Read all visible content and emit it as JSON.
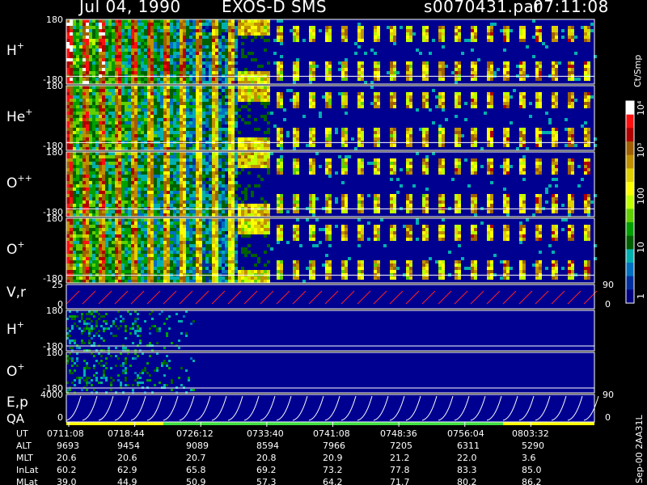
{
  "header": {
    "date": "Jul 04, 1990",
    "instrument": "EXOS-D SMS",
    "file": "s0070431.par",
    "file_time": "07:11:08"
  },
  "chart_data": {
    "type": "heatmap",
    "time_ticks": [
      "0711:08",
      "0718:44",
      "0726:12",
      "0733:40",
      "0741:08",
      "0748:36",
      "0756:04",
      "0803:32"
    ],
    "panels": [
      {
        "id": "h-plus",
        "ion": "H",
        "sup": "+",
        "ymax": "180",
        "ymin": "-180"
      },
      {
        "id": "he-plus",
        "ion": "He",
        "sup": "+",
        "ymax": "180",
        "ymin": "-180"
      },
      {
        "id": "o-plus-plus",
        "ion": "O",
        "sup": "++",
        "ymax": "180",
        "ymin": "-180"
      },
      {
        "id": "o-plus",
        "ion": "O",
        "sup": "+",
        "ymax": "180",
        "ymin": "-180"
      },
      {
        "id": "vr",
        "ion": "V,r",
        "sup": "",
        "ymax": "25",
        "ymin": "0",
        "right_top": "90",
        "right_bottom": "0"
      },
      {
        "id": "h-plus-2",
        "ion": "H",
        "sup": "+",
        "ymax": "180",
        "ymin": "-180"
      },
      {
        "id": "o-plus-2",
        "ion": "O",
        "sup": "+",
        "ymax": "180",
        "ymin": "-180"
      },
      {
        "id": "ep",
        "ion": "E,p",
        "sup": "",
        "ymax": "4000",
        "ymin": "0",
        "right_top": "90",
        "right_bottom": "0"
      }
    ],
    "qa_label": "QA",
    "colorbar": {
      "unit": "Ct/Smp",
      "ticks": [
        "10⁴",
        "10³",
        "100",
        "10",
        "1"
      ],
      "colors": [
        "#ffffff",
        "#ff1010",
        "#b00000",
        "#a06000",
        "#c09000",
        "#e0d000",
        "#ffff00",
        "#c0ff00",
        "#60d000",
        "#00a000",
        "#006000",
        "#00b0b0",
        "#0070c0",
        "#0030a0",
        "#000080"
      ]
    },
    "orbit_table": {
      "rows": [
        {
          "label": "UT",
          "values": [
            "0711:08",
            "0718:44",
            "0726:12",
            "0733:40",
            "0741:08",
            "0748:36",
            "0756:04",
            "0803:32"
          ]
        },
        {
          "label": "ALT",
          "values": [
            "9693",
            "9454",
            "9089",
            "8594",
            "7966",
            "7205",
            "6311",
            "5290"
          ]
        },
        {
          "label": "MLT",
          "values": [
            "20.6",
            "20.6",
            "20.7",
            "20.8",
            "20.9",
            "21.2",
            "22.0",
            "3.6"
          ]
        },
        {
          "label": "InLat",
          "values": [
            "60.2",
            "62.9",
            "65.8",
            "69.2",
            "73.2",
            "77.8",
            "83.3",
            "85.0"
          ]
        },
        {
          "label": "MLat",
          "values": [
            "39.0",
            "44.9",
            "50.9",
            "57.3",
            "64.2",
            "71.7",
            "80.2",
            "86.2"
          ]
        }
      ]
    },
    "side_label": "Sep-00 2AA31L"
  }
}
